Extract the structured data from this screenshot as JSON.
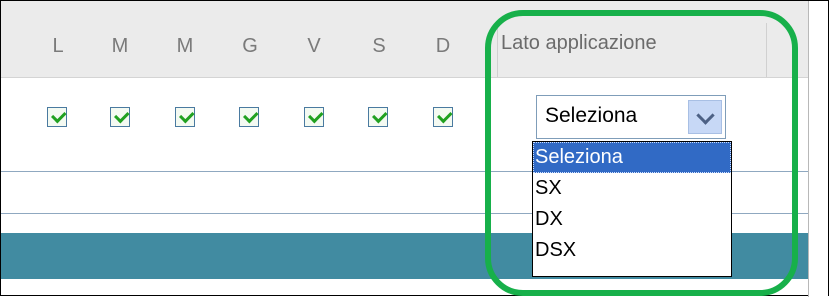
{
  "days": [
    "L",
    "M",
    "M",
    "G",
    "V",
    "S",
    "D"
  ],
  "day_checked": [
    true,
    true,
    true,
    true,
    true,
    true,
    true
  ],
  "column_header": "Lato applicazione",
  "select": {
    "value": "Seleziona",
    "options": [
      "Seleziona",
      "SX",
      "DX",
      "DSX"
    ]
  },
  "colors": {
    "highlight": "#17b04a",
    "teal_bar": "#418ba1",
    "selected_option": "#316ac5",
    "check": "#21a121"
  }
}
